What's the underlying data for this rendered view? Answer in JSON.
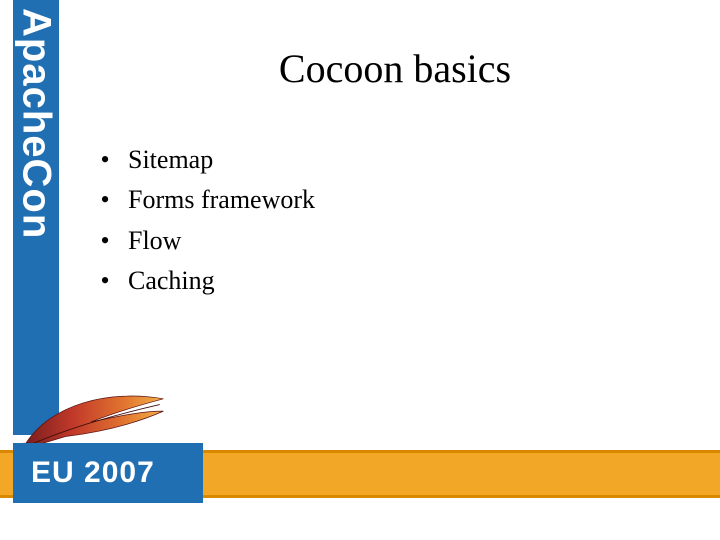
{
  "brand": {
    "vertical_text": "ApacheCon",
    "eu_label": "EU 2007"
  },
  "title": "Cocoon basics",
  "bullets": [
    "Sitemap",
    "Forms framework",
    "Flow",
    "Caching"
  ],
  "colors": {
    "brand_blue": "#1f6fb2",
    "footer_orange": "#f2a826"
  }
}
